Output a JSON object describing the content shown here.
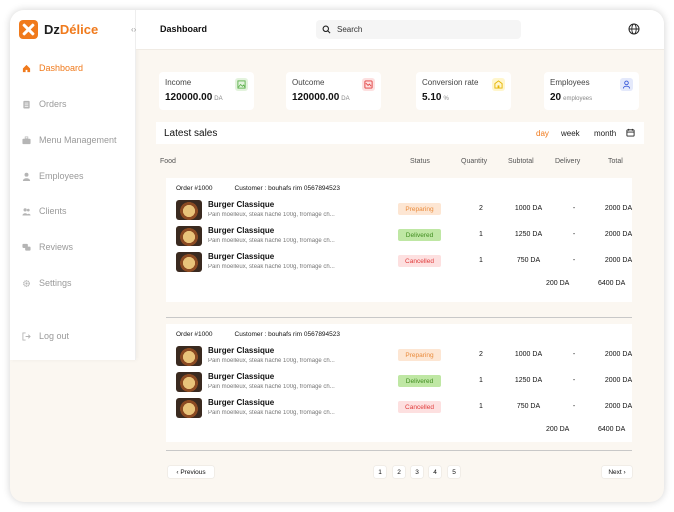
{
  "brand": {
    "part1": "Dz",
    "part2": "Délice",
    "accent": "#f07a1c"
  },
  "collapse_icon": "‹›",
  "sidebar": {
    "items": [
      {
        "label": "Dashboard",
        "icon": "home-icon",
        "active": true
      },
      {
        "label": "Orders",
        "icon": "clipboard-icon"
      },
      {
        "label": "Menu Management",
        "icon": "briefcase-icon"
      },
      {
        "label": "Employees",
        "icon": "user-icon"
      },
      {
        "label": "Clients",
        "icon": "users-icon"
      },
      {
        "label": "Reviews",
        "icon": "chat-icon"
      },
      {
        "label": "Settings",
        "icon": "gear-icon"
      },
      {
        "label": "Log out",
        "icon": "logout-icon"
      }
    ]
  },
  "header": {
    "title": "Dashboard",
    "search_placeholder": "Search"
  },
  "stats": [
    {
      "label": "Income",
      "value": "120000.00",
      "unit": "DA",
      "icon": "image-icon",
      "color": "#5bb04a",
      "bg": "#e3f3dd"
    },
    {
      "label": "Outcome",
      "value": "120000.00",
      "unit": "DA",
      "icon": "chart-down-icon",
      "color": "#e03b3b",
      "bg": "#fde0e0"
    },
    {
      "label": "Conversion rate",
      "value": "5.10",
      "unit": "%",
      "icon": "building-icon",
      "color": "#e6b400",
      "bg": "#fff6cc"
    },
    {
      "label": "Employees",
      "value": "20",
      "unit": "employees",
      "icon": "person-icon",
      "color": "#3a5bd9",
      "bg": "#e4e9fb"
    }
  ],
  "sales": {
    "title": "Latest sales",
    "filters": [
      "day",
      "week",
      "month"
    ],
    "active_filter": "day",
    "columns": [
      "Food",
      "Status",
      "Quantity",
      "Subtotal",
      "Delivery",
      "Total"
    ],
    "orders": [
      {
        "order_label": "Order #1000",
        "customer_label": "Customer : bouhafs rim 0567894523",
        "items": [
          {
            "name": "Burger Classique",
            "desc": "Pain moelleux, steak haché 100g, fromage ch...",
            "status": "Preparing",
            "status_class": "preparing",
            "quantity": "2",
            "subtotal": "1000 DA",
            "delivery": "-",
            "total": "2000 DA"
          },
          {
            "name": "Burger Classique",
            "desc": "Pain moelleux, steak haché 100g, fromage ch...",
            "status": "Delivered",
            "status_class": "delivered",
            "quantity": "1",
            "subtotal": "1250 DA",
            "delivery": "-",
            "total": "2000 DA"
          },
          {
            "name": "Burger Classique",
            "desc": "Pain moelleux, steak haché 100g, fromage ch...",
            "status": "Cancelled",
            "status_class": "cancelled",
            "quantity": "1",
            "subtotal": "750 DA",
            "delivery": "-",
            "total": "2000 DA"
          }
        ],
        "delivery_total": "200 DA",
        "grand_total": "6400 DA"
      },
      {
        "order_label": "Order #1000",
        "customer_label": "Customer : bouhafs rim 0567894523",
        "items": [
          {
            "name": "Burger Classique",
            "desc": "Pain moelleux, steak haché 100g, fromage ch...",
            "status": "Preparing",
            "status_class": "preparing",
            "quantity": "2",
            "subtotal": "1000 DA",
            "delivery": "-",
            "total": "2000 DA"
          },
          {
            "name": "Burger Classique",
            "desc": "Pain moelleux, steak haché 100g, fromage ch...",
            "status": "Delivered",
            "status_class": "delivered",
            "quantity": "1",
            "subtotal": "1250 DA",
            "delivery": "-",
            "total": "2000 DA"
          },
          {
            "name": "Burger Classique",
            "desc": "Pain moelleux, steak haché 100g, fromage ch...",
            "status": "Cancelled",
            "status_class": "cancelled",
            "quantity": "1",
            "subtotal": "750 DA",
            "delivery": "-",
            "total": "2000 DA"
          }
        ],
        "delivery_total": "200 DA",
        "grand_total": "6400 DA"
      }
    ]
  },
  "pagination": {
    "previous": "‹ Previous",
    "next": "Next ›",
    "pages": [
      "1",
      "2",
      "3",
      "4",
      "5"
    ]
  }
}
